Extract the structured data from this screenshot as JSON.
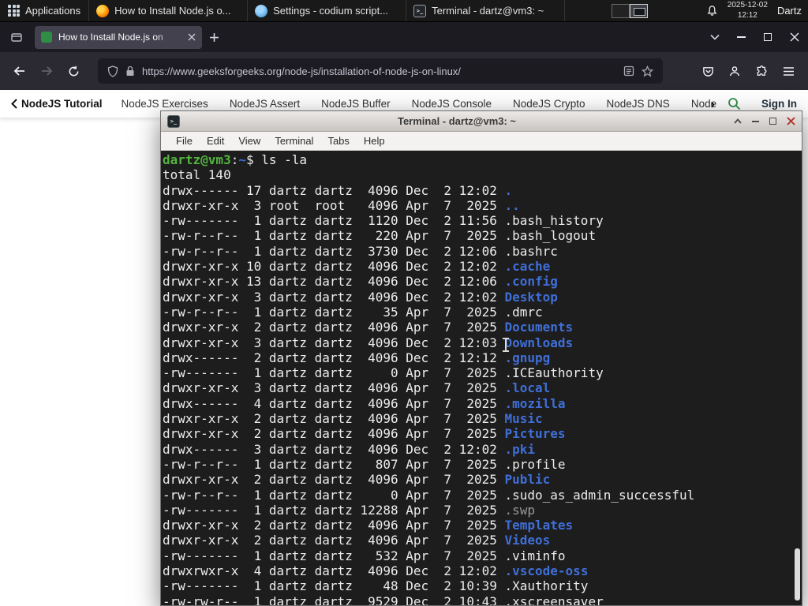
{
  "taskbar": {
    "applications_label": "Applications",
    "windows": [
      {
        "icon": "firefox",
        "title": "How to Install Node.js o..."
      },
      {
        "icon": "settings",
        "title": "Settings - codium script..."
      },
      {
        "icon": "terminal",
        "title": "Terminal - dartz@vm3: ~"
      }
    ],
    "date": "2025-12-02",
    "time": "12:12",
    "user": "Dartz"
  },
  "browser": {
    "tab_title": "How to Install Node.js on",
    "url": "https://www.geeksforgeeks.org/node-js/installation-of-node-js-on-linux/"
  },
  "site_nav": {
    "back_label": "NodeJS Tutorial",
    "items": [
      "NodeJS Exercises",
      "NodeJS Assert",
      "NodeJS Buffer",
      "NodeJS Console",
      "NodeJS Crypto",
      "NodeJS DNS",
      "Node"
    ],
    "sign_in_label": "Sign In"
  },
  "terminal_window": {
    "title": "Terminal - dartz@vm3: ~",
    "menu": [
      "File",
      "Edit",
      "View",
      "Terminal",
      "Tabs",
      "Help"
    ],
    "lines": [
      [
        {
          "t": "dartz@vm3",
          "c": "green"
        },
        {
          "t": ":",
          "c": "fg"
        },
        {
          "t": "~",
          "c": "blue"
        },
        {
          "t": "$ ls -la",
          "c": "fg"
        }
      ],
      [
        {
          "t": "total 140",
          "c": "fg"
        }
      ],
      [
        {
          "t": "drwx------ 17 dartz dartz  4096 Dec  2 12:02 ",
          "c": "fg"
        },
        {
          "t": ".",
          "c": "blue"
        }
      ],
      [
        {
          "t": "drwxr-xr-x  3 root  root   4096 Apr  7  2025 ",
          "c": "fg"
        },
        {
          "t": "..",
          "c": "blue"
        }
      ],
      [
        {
          "t": "-rw-------  1 dartz dartz  1120 Dec  2 11:56 .bash_history",
          "c": "fg"
        }
      ],
      [
        {
          "t": "-rw-r--r--  1 dartz dartz   220 Apr  7  2025 .bash_logout",
          "c": "fg"
        }
      ],
      [
        {
          "t": "-rw-r--r--  1 dartz dartz  3730 Dec  2 12:06 .bashrc",
          "c": "fg"
        }
      ],
      [
        {
          "t": "drwxr-xr-x 10 dartz dartz  4096 Dec  2 12:02 ",
          "c": "fg"
        },
        {
          "t": ".cache",
          "c": "blue"
        }
      ],
      [
        {
          "t": "drwxr-xr-x 13 dartz dartz  4096 Dec  2 12:06 ",
          "c": "fg"
        },
        {
          "t": ".config",
          "c": "blue"
        }
      ],
      [
        {
          "t": "drwxr-xr-x  3 dartz dartz  4096 Dec  2 12:02 ",
          "c": "fg"
        },
        {
          "t": "Desktop",
          "c": "blue"
        }
      ],
      [
        {
          "t": "-rw-r--r--  1 dartz dartz    35 Apr  7  2025 .dmrc",
          "c": "fg"
        }
      ],
      [
        {
          "t": "drwxr-xr-x  2 dartz dartz  4096 Apr  7  2025 ",
          "c": "fg"
        },
        {
          "t": "Documents",
          "c": "blue"
        }
      ],
      [
        {
          "t": "drwxr-xr-x  3 dartz dartz  4096 Dec  2 12:03 ",
          "c": "fg"
        },
        {
          "t": "Downloads",
          "c": "blue"
        }
      ],
      [
        {
          "t": "drwx------  2 dartz dartz  4096 Dec  2 12:12 ",
          "c": "fg"
        },
        {
          "t": ".gnupg",
          "c": "blue"
        }
      ],
      [
        {
          "t": "-rw-------  1 dartz dartz     0 Apr  7  2025 .ICEauthority",
          "c": "fg"
        }
      ],
      [
        {
          "t": "drwxr-xr-x  3 dartz dartz  4096 Apr  7  2025 ",
          "c": "fg"
        },
        {
          "t": ".local",
          "c": "blue"
        }
      ],
      [
        {
          "t": "drwx------  4 dartz dartz  4096 Apr  7  2025 ",
          "c": "fg"
        },
        {
          "t": ".mozilla",
          "c": "blue"
        }
      ],
      [
        {
          "t": "drwxr-xr-x  2 dartz dartz  4096 Apr  7  2025 ",
          "c": "fg"
        },
        {
          "t": "Music",
          "c": "blue"
        }
      ],
      [
        {
          "t": "drwxr-xr-x  2 dartz dartz  4096 Apr  7  2025 ",
          "c": "fg"
        },
        {
          "t": "Pictures",
          "c": "blue"
        }
      ],
      [
        {
          "t": "drwx------  3 dartz dartz  4096 Dec  2 12:02 ",
          "c": "fg"
        },
        {
          "t": ".pki",
          "c": "blue"
        }
      ],
      [
        {
          "t": "-rw-r--r--  1 dartz dartz   807 Apr  7  2025 .profile",
          "c": "fg"
        }
      ],
      [
        {
          "t": "drwxr-xr-x  2 dartz dartz  4096 Apr  7  2025 ",
          "c": "fg"
        },
        {
          "t": "Public",
          "c": "blue"
        }
      ],
      [
        {
          "t": "-rw-r--r--  1 dartz dartz     0 Apr  7  2025 .sudo_as_admin_successful",
          "c": "fg"
        }
      ],
      [
        {
          "t": "-rw-------  1 dartz dartz 12288 Apr  7  2025 ",
          "c": "fg"
        },
        {
          "t": ".swp",
          "c": "dim"
        }
      ],
      [
        {
          "t": "drwxr-xr-x  2 dartz dartz  4096 Apr  7  2025 ",
          "c": "fg"
        },
        {
          "t": "Templates",
          "c": "blue"
        }
      ],
      [
        {
          "t": "drwxr-xr-x  2 dartz dartz  4096 Apr  7  2025 ",
          "c": "fg"
        },
        {
          "t": "Videos",
          "c": "blue"
        }
      ],
      [
        {
          "t": "-rw-------  1 dartz dartz   532 Apr  7  2025 .viminfo",
          "c": "fg"
        }
      ],
      [
        {
          "t": "drwxrwxr-x  4 dartz dartz  4096 Dec  2 12:02 ",
          "c": "fg"
        },
        {
          "t": ".vscode-oss",
          "c": "blue"
        }
      ],
      [
        {
          "t": "-rw-------  1 dartz dartz    48 Dec  2 10:39 .Xauthority",
          "c": "fg"
        }
      ],
      [
        {
          "t": "-rw-rw-r--  1 dartz dartz  9529 Dec  2 10:43 .xscreensaver",
          "c": "fg"
        }
      ]
    ]
  },
  "colors": {
    "dir_blue": "#3f6fd8",
    "prompt_green": "#53b43e",
    "brand_green": "#2f8d46",
    "terminal_bg": "#1d1d1d",
    "toolbar_dark": "#2b2a33"
  }
}
